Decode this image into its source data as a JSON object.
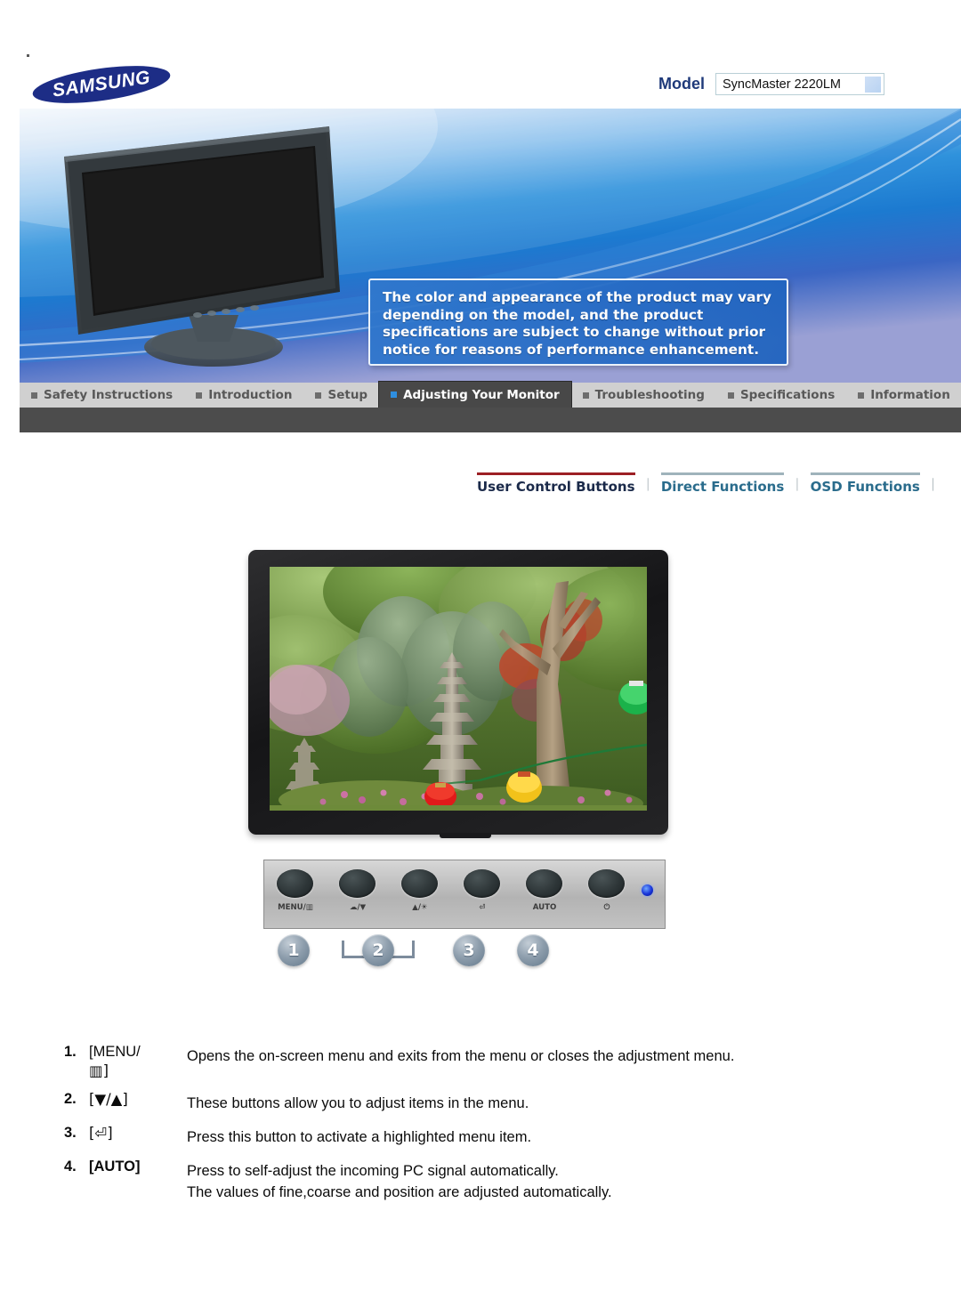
{
  "header": {
    "logo_text": "SAMSUNG",
    "model_label": "Model",
    "model_value": "SyncMaster 2220LM"
  },
  "banner": {
    "notice": "The color and appearance of the product may vary depending on the model, and the product specifications are subject to change without prior notice for reasons of performance enhancement."
  },
  "tabs": [
    {
      "label": "Safety Instructions",
      "active": false
    },
    {
      "label": "Introduction",
      "active": false
    },
    {
      "label": "Setup",
      "active": false
    },
    {
      "label": "Adjusting Your Monitor",
      "active": true
    },
    {
      "label": "Troubleshooting",
      "active": false
    },
    {
      "label": "Specifications",
      "active": false
    },
    {
      "label": "Information",
      "active": false
    }
  ],
  "subnav": {
    "items": [
      {
        "label": "User Control Buttons",
        "style": "primary"
      },
      {
        "label": "Direct Functions",
        "style": "secondary"
      },
      {
        "label": "OSD Functions",
        "style": "secondary"
      }
    ],
    "separator": "⏐"
  },
  "control_panel": {
    "buttons": [
      {
        "label": "MENU/▥"
      },
      {
        "label": "☁/▼"
      },
      {
        "label": "▲/☀"
      },
      {
        "label": "⏎"
      },
      {
        "label": "AUTO"
      },
      {
        "label": "⏻"
      }
    ],
    "led_name": "power-led"
  },
  "badges": [
    "1",
    "2",
    "3",
    "4"
  ],
  "descriptions": [
    {
      "num": "1.",
      "key_line1": "[MENU/",
      "key_line2": "▥]",
      "lines": [
        "Opens the on-screen menu and exits from the menu or closes the adjustment menu."
      ]
    },
    {
      "num": "2.",
      "key_line1": "[▼/▲]",
      "key_line2": "",
      "lines": [
        "These buttons allow you to adjust items in the menu."
      ]
    },
    {
      "num": "3.",
      "key_line1": "[⏎]",
      "key_line2": "",
      "lines": [
        "Press this button to activate a highlighted menu item."
      ]
    },
    {
      "num": "4.",
      "key_line1": "[AUTO]",
      "key_line2": "",
      "lines": [
        "Press to self-adjust the incoming PC signal automatically.",
        "The values of fine,coarse and position are adjusted automatically."
      ]
    }
  ],
  "colors": {
    "accent_blue": "#1f7fd4",
    "tab_active_bg": "#484848",
    "tab_active_marker": "#2f8fe0",
    "subnav_primary_bar": "#9c1f24",
    "subnav_secondary_text": "#2a6c8c",
    "logo_blue": "#1d2d86"
  }
}
